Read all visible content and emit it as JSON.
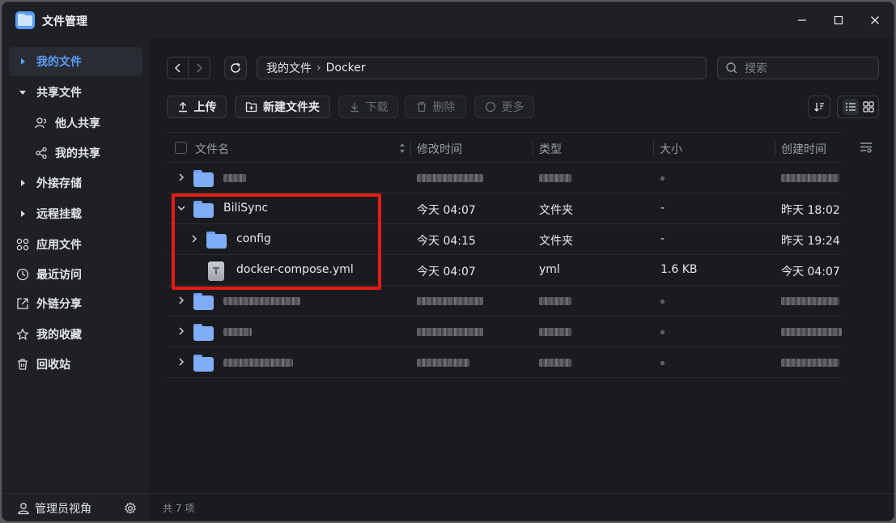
{
  "window": {
    "title": "文件管理",
    "app_icon": "file-manager-icon"
  },
  "sidebar": {
    "items": [
      {
        "label": "我的文件",
        "icon": "caret-right-icon",
        "active": true
      },
      {
        "label": "共享文件",
        "icon": "caret-down-icon"
      },
      {
        "label": "他人共享",
        "icon": "users-icon",
        "sub": true
      },
      {
        "label": "我的共享",
        "icon": "share-icon",
        "sub": true
      },
      {
        "label": "外接存储",
        "icon": "caret-right-icon"
      },
      {
        "label": "远程挂载",
        "icon": "caret-right-icon"
      },
      {
        "label": "应用文件",
        "icon": "apps-icon"
      },
      {
        "label": "最近访问",
        "icon": "clock-icon"
      },
      {
        "label": "外链分享",
        "icon": "external-link-icon"
      },
      {
        "label": "我的收藏",
        "icon": "star-icon"
      },
      {
        "label": "回收站",
        "icon": "trash-icon"
      }
    ],
    "footer_label": "管理员视角"
  },
  "toolbar": {
    "path": [
      "我的文件",
      "Docker"
    ],
    "search_placeholder": "搜索",
    "upload": "上传",
    "new_folder": "新建文件夹",
    "download": "下载",
    "delete": "删除",
    "more": "更多"
  },
  "table": {
    "headers": {
      "name": "文件名",
      "modified": "修改时间",
      "type": "类型",
      "size": "大小",
      "created": "创建时间"
    },
    "rows": [
      {
        "name": "",
        "blurred": true
      },
      {
        "name": "BiliSync",
        "modified": "今天 04:07",
        "type": "文件夹",
        "size": "-",
        "created": "昨天 18:02",
        "expanded": true
      },
      {
        "name": "config",
        "modified": "今天 04:15",
        "type": "文件夹",
        "size": "-",
        "created": "昨天 19:24",
        "child": true
      },
      {
        "name": "docker-compose.yml",
        "modified": "今天 04:07",
        "type": "yml",
        "size": "1.6 KB",
        "created": "今天 04:07",
        "child": true,
        "file": true,
        "file_letter": "T"
      },
      {
        "name": "",
        "blurred": true
      },
      {
        "name": "",
        "blurred": true
      },
      {
        "name": "",
        "blurred": true
      }
    ]
  },
  "footer": {
    "count": "共 7 项"
  },
  "colors": {
    "accent": "#5b9cf8",
    "highlight": "#e61b16",
    "folder": "#7fadf7"
  }
}
